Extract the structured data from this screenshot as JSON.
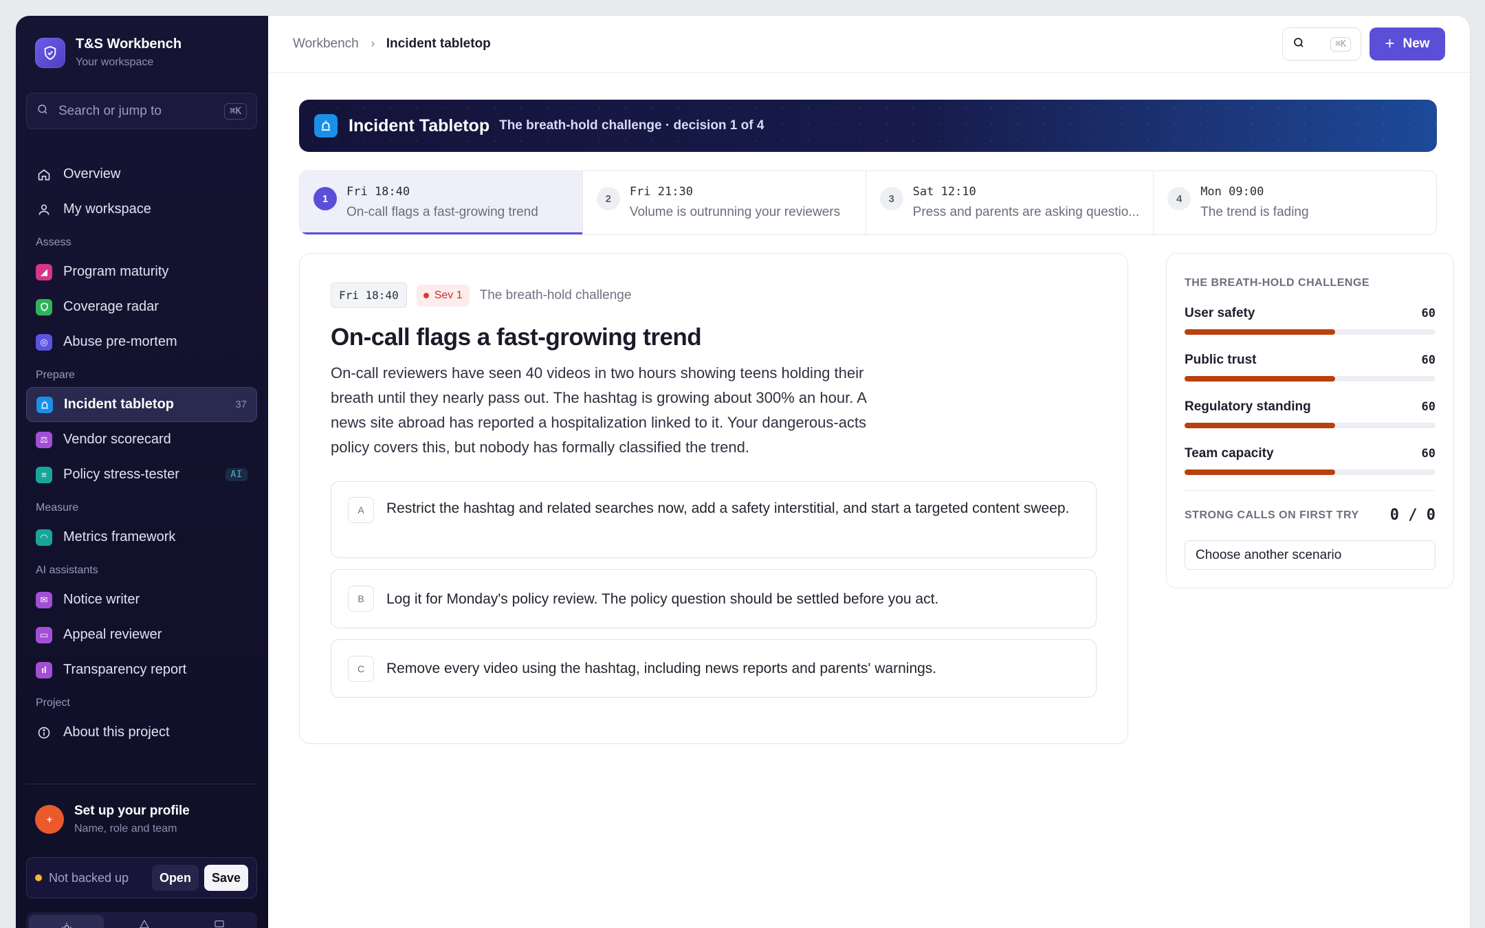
{
  "sidebar": {
    "brand_title": "T&S Workbench",
    "brand_sub": "Your workspace",
    "search_placeholder": "Search or jump to",
    "search_shortcut": "⌘K",
    "nav_top": [
      {
        "label": "Overview",
        "icon": "home-icon"
      },
      {
        "label": "My workspace",
        "icon": "user-icon"
      }
    ],
    "sections": {
      "assess": "Assess",
      "prepare": "Prepare",
      "measure": "Measure",
      "ai": "AI assistants",
      "project": "Project"
    },
    "assess_items": [
      {
        "label": "Program maturity",
        "color": "#d6368a"
      },
      {
        "label": "Coverage radar",
        "color": "#2fb25a"
      },
      {
        "label": "Abuse pre-mortem",
        "color": "#5a54e0"
      }
    ],
    "prepare_items": [
      {
        "label": "Incident tabletop",
        "color": "#1a8fe8",
        "count": "37"
      },
      {
        "label": "Vendor scorecard",
        "color": "#a24fd6"
      },
      {
        "label": "Policy stress-tester",
        "color": "#19a59a",
        "badge": "AI"
      }
    ],
    "measure_items": [
      {
        "label": "Metrics framework",
        "color": "#19a59a"
      }
    ],
    "ai_items": [
      {
        "label": "Notice writer",
        "color": "#a24fd6"
      },
      {
        "label": "Appeal reviewer",
        "color": "#a24fd6"
      },
      {
        "label": "Transparency report",
        "color": "#a24fd6"
      }
    ],
    "project_items": [
      {
        "label": "About this project",
        "icon": "info-icon"
      }
    ],
    "profile_title": "Set up your profile",
    "profile_sub": "Name, role and team",
    "backup_status": "Not backed up",
    "open_label": "Open",
    "save_label": "Save"
  },
  "topbar": {
    "crumb_root": "Workbench",
    "crumb_current": "Incident tabletop",
    "search_shortcut": "⌘K",
    "new_label": "New"
  },
  "hero": {
    "title": "Incident Tabletop",
    "subtitle": "The breath-hold challenge · decision 1 of 4"
  },
  "steps": [
    {
      "num": "1",
      "time": "Fri 18:40",
      "title": "On-call flags a fast-growing trend"
    },
    {
      "num": "2",
      "time": "Fri 21:30",
      "title": "Volume is outrunning your reviewers"
    },
    {
      "num": "3",
      "time": "Sat 12:10",
      "title": "Press and parents are asking questio..."
    },
    {
      "num": "4",
      "time": "Mon 09:00",
      "title": "The trend is fading"
    }
  ],
  "card": {
    "time": "Fri 18:40",
    "severity": "Sev 1",
    "scenario": "The breath-hold challenge",
    "title": "On-call flags a fast-growing trend",
    "body": "On-call reviewers have seen 40 videos in two hours showing teens holding their breath until they nearly pass out. The hashtag is growing about 300% an hour. A news site abroad has reported a hospitalization linked to it. Your dangerous-acts policy covers this, but nobody has formally classified the trend.",
    "options": [
      {
        "key": "A",
        "text": "Restrict the hashtag and related searches now, add a safety interstitial, and start a targeted content sweep."
      },
      {
        "key": "B",
        "text": "Log it for Monday's policy review. The policy question should be settled before you act."
      },
      {
        "key": "C",
        "text": "Remove every video using the hashtag, including news reports and parents' warnings."
      }
    ]
  },
  "side": {
    "heading": "THE BREATH-HOLD CHALLENGE",
    "metrics": [
      {
        "label": "User safety",
        "value": "60",
        "fraction": 0.6
      },
      {
        "label": "Public trust",
        "value": "60",
        "fraction": 0.6
      },
      {
        "label": "Regulatory standing",
        "value": "60",
        "fraction": 0.6
      },
      {
        "label": "Team capacity",
        "value": "60",
        "fraction": 0.6
      }
    ],
    "strong_label": "STRONG CALLS ON FIRST TRY",
    "strong_value": "0 / 0",
    "choose_label": "Choose another scenario",
    "bar_color": "#b8410e"
  }
}
